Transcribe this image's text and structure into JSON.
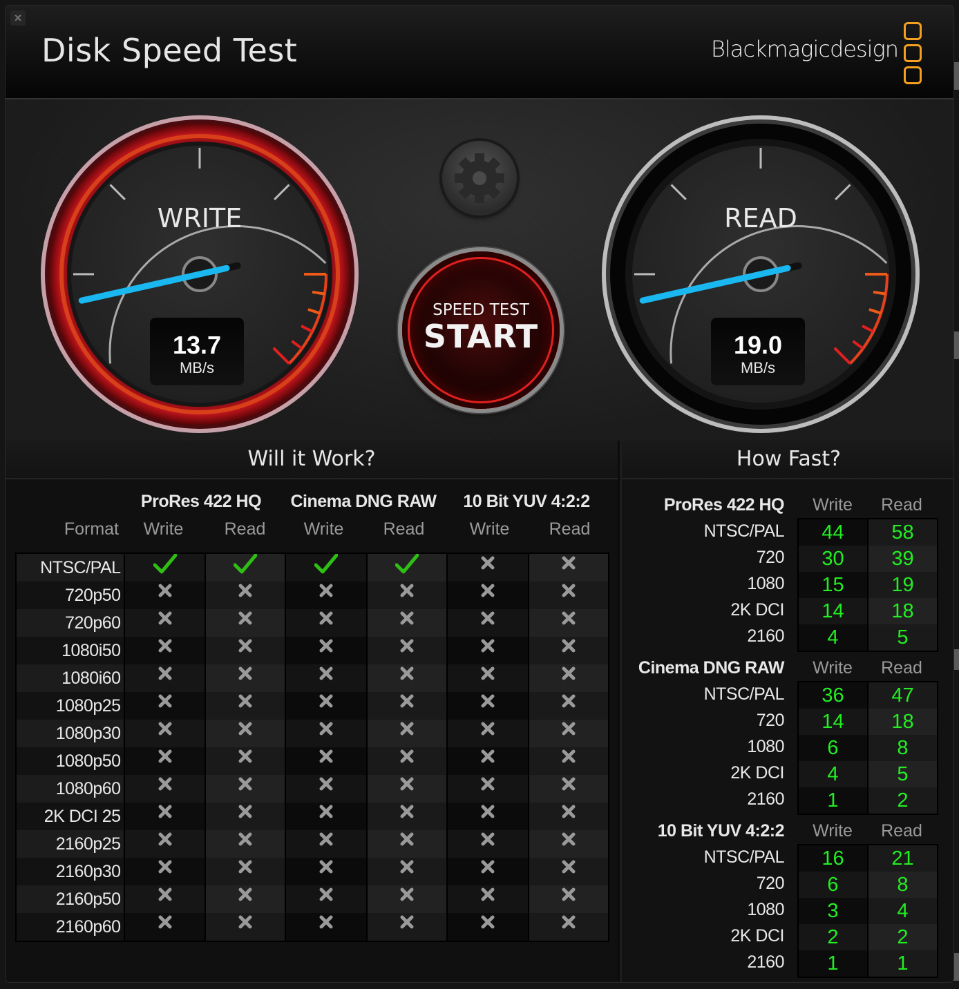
{
  "window": {
    "title": "Disk Speed Test",
    "brand": "Blackmagicdesign",
    "close_label": "×"
  },
  "gauges": {
    "write": {
      "label": "WRITE",
      "value": "13.7",
      "unit": "MB/s",
      "needle_fraction": 0.12
    },
    "read": {
      "label": "READ",
      "value": "19.0",
      "unit": "MB/s",
      "needle_fraction": 0.12
    }
  },
  "controls": {
    "settings_icon": "gear-icon",
    "start_small": "SPEED TEST",
    "start_big": "START"
  },
  "colors": {
    "accent_green": "#22ee22",
    "needle_blue": "#1ab8f0",
    "write_ring_red": "#c0151c",
    "brand_orange": "#f5a020"
  },
  "will_it_work": {
    "title": "Will it Work?",
    "format_header": "Format",
    "groups": [
      "ProRes 422 HQ",
      "Cinema DNG RAW",
      "10 Bit YUV 4:2:2"
    ],
    "subheaders": [
      "Write",
      "Read",
      "Write",
      "Read",
      "Write",
      "Read"
    ],
    "rows": [
      {
        "format": "NTSC/PAL",
        "results": [
          "check",
          "check",
          "check",
          "check",
          "cross",
          "cross"
        ]
      },
      {
        "format": "720p50",
        "results": [
          "cross",
          "cross",
          "cross",
          "cross",
          "cross",
          "cross"
        ]
      },
      {
        "format": "720p60",
        "results": [
          "cross",
          "cross",
          "cross",
          "cross",
          "cross",
          "cross"
        ]
      },
      {
        "format": "1080i50",
        "results": [
          "cross",
          "cross",
          "cross",
          "cross",
          "cross",
          "cross"
        ]
      },
      {
        "format": "1080i60",
        "results": [
          "cross",
          "cross",
          "cross",
          "cross",
          "cross",
          "cross"
        ]
      },
      {
        "format": "1080p25",
        "results": [
          "cross",
          "cross",
          "cross",
          "cross",
          "cross",
          "cross"
        ]
      },
      {
        "format": "1080p30",
        "results": [
          "cross",
          "cross",
          "cross",
          "cross",
          "cross",
          "cross"
        ]
      },
      {
        "format": "1080p50",
        "results": [
          "cross",
          "cross",
          "cross",
          "cross",
          "cross",
          "cross"
        ]
      },
      {
        "format": "1080p60",
        "results": [
          "cross",
          "cross",
          "cross",
          "cross",
          "cross",
          "cross"
        ]
      },
      {
        "format": "2K DCI 25",
        "results": [
          "cross",
          "cross",
          "cross",
          "cross",
          "cross",
          "cross"
        ]
      },
      {
        "format": "2160p25",
        "results": [
          "cross",
          "cross",
          "cross",
          "cross",
          "cross",
          "cross"
        ]
      },
      {
        "format": "2160p30",
        "results": [
          "cross",
          "cross",
          "cross",
          "cross",
          "cross",
          "cross"
        ]
      },
      {
        "format": "2160p50",
        "results": [
          "cross",
          "cross",
          "cross",
          "cross",
          "cross",
          "cross"
        ]
      },
      {
        "format": "2160p60",
        "results": [
          "cross",
          "cross",
          "cross",
          "cross",
          "cross",
          "cross"
        ]
      }
    ]
  },
  "how_fast": {
    "title": "How Fast?",
    "groups": [
      {
        "name": "ProRes 422 HQ",
        "write_header": "Write",
        "read_header": "Read",
        "rows": [
          {
            "format": "NTSC/PAL",
            "write": "44",
            "read": "58"
          },
          {
            "format": "720",
            "write": "30",
            "read": "39"
          },
          {
            "format": "1080",
            "write": "15",
            "read": "19"
          },
          {
            "format": "2K DCI",
            "write": "14",
            "read": "18"
          },
          {
            "format": "2160",
            "write": "4",
            "read": "5"
          }
        ]
      },
      {
        "name": "Cinema DNG RAW",
        "write_header": "Write",
        "read_header": "Read",
        "rows": [
          {
            "format": "NTSC/PAL",
            "write": "36",
            "read": "47"
          },
          {
            "format": "720",
            "write": "14",
            "read": "18"
          },
          {
            "format": "1080",
            "write": "6",
            "read": "8"
          },
          {
            "format": "2K DCI",
            "write": "4",
            "read": "5"
          },
          {
            "format": "2160",
            "write": "1",
            "read": "2"
          }
        ]
      },
      {
        "name": "10 Bit YUV 4:2:2",
        "write_header": "Write",
        "read_header": "Read",
        "rows": [
          {
            "format": "NTSC/PAL",
            "write": "16",
            "read": "21"
          },
          {
            "format": "720",
            "write": "6",
            "read": "8"
          },
          {
            "format": "1080",
            "write": "3",
            "read": "4"
          },
          {
            "format": "2K DCI",
            "write": "2",
            "read": "2"
          },
          {
            "format": "2160",
            "write": "1",
            "read": "1"
          }
        ]
      }
    ]
  }
}
